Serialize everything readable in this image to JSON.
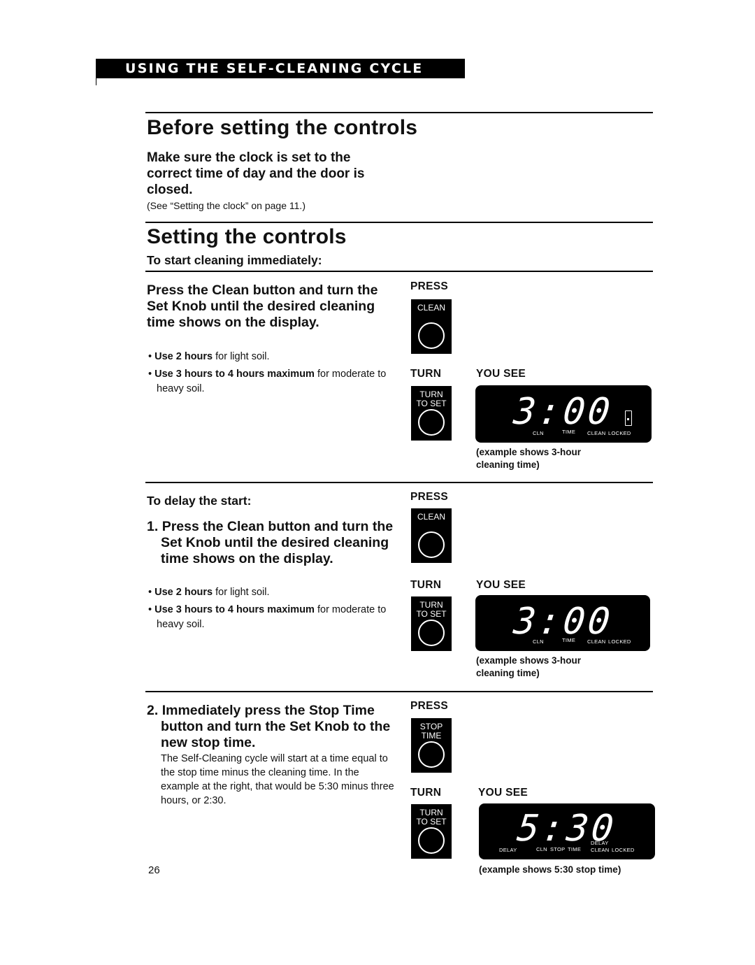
{
  "banner": {
    "title": "USING THE SELF-CLEANING CYCLE"
  },
  "before": {
    "heading": "Before setting the controls",
    "instruction": "Make sure the clock is set to the correct time of day and the door is closed.",
    "note": "(See “Setting the clock” on page 11.)"
  },
  "setting": {
    "heading": "Setting the controls",
    "immediate": {
      "subheading": "To start cleaning immediately:",
      "instruction": "Press the Clean button and turn the Set Knob until the desired cleaning time shows on the display.",
      "bullets": [
        {
          "bold": "Use 2 hours",
          "rest": " for light soil."
        },
        {
          "bold": "Use 3 hours to 4 hours maximum",
          "rest": " for moderate to heavy soil."
        }
      ],
      "press_label": "PRESS",
      "press_button": "CLEAN",
      "turn_label": "TURN",
      "turn_button": "TURN TO SET",
      "you_see_label": "YOU SEE",
      "display": {
        "time": "3:00",
        "indicators": [
          "CLN",
          "TIME",
          "CLEAN",
          "LOCKED"
        ]
      },
      "caption": "(example shows 3-hour cleaning time)"
    },
    "delay": {
      "subheading": "To delay the start:",
      "step1": {
        "number": "1.",
        "instruction": "Press the Clean button and turn the Set Knob until the desired cleaning time shows on the display.",
        "bullets": [
          {
            "bold": "Use 2 hours",
            "rest": " for light soil."
          },
          {
            "bold": "Use 3 hours to 4 hours maximum",
            "rest": " for moderate to heavy soil."
          }
        ],
        "press_label": "PRESS",
        "press_button": "CLEAN",
        "turn_label": "TURN",
        "turn_button": "TURN TO SET",
        "you_see_label": "YOU SEE",
        "display": {
          "time": "3:00",
          "indicators": [
            "CLN",
            "TIME",
            "CLEAN",
            "LOCKED"
          ]
        },
        "caption": "(example shows 3-hour cleaning time)"
      },
      "step2": {
        "number": "2.",
        "instruction": "Immediately press the Stop Time button and turn the Set Knob to the new stop time.",
        "paragraph": "The Self-Cleaning cycle will start at a time equal to the stop time minus the cleaning time. In the example at the right, that would be 5:30 minus three hours, or 2:30.",
        "press_label": "PRESS",
        "press_button": "STOP TIME",
        "turn_label": "TURN",
        "turn_button": "TURN TO SET",
        "you_see_label": "YOU SEE",
        "display": {
          "time": "5:30",
          "indicators": [
            "DELAY",
            "CLN",
            "STOP",
            "TIME",
            "DELAY",
            "CLEAN",
            "LOCKED"
          ]
        },
        "caption": "(example shows 5:30 stop time)"
      }
    }
  },
  "page_number": "26"
}
